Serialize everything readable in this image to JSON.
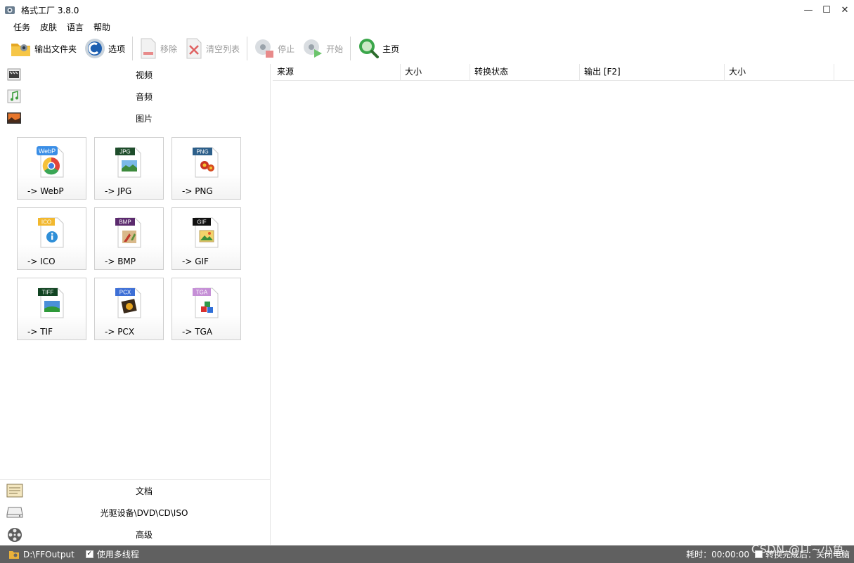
{
  "window": {
    "title": "格式工厂 3.8.0",
    "controls": [
      "—",
      "☐",
      "✕"
    ]
  },
  "menu": [
    "任务",
    "皮肤",
    "语言",
    "帮助"
  ],
  "toolbar": {
    "output_folder": "输出文件夹",
    "options": "选项",
    "remove": "移除",
    "clear_list": "清空列表",
    "stop": "停止",
    "start": "开始",
    "home": "主页"
  },
  "categories_top": [
    "视频",
    "音频",
    "图片"
  ],
  "image_formats": [
    {
      "badge": "WebP",
      "label": "-> WebP",
      "badge_color": "#3a8ee6"
    },
    {
      "badge": "JPG",
      "label": "-> JPG",
      "badge_color": "#1e4d2b"
    },
    {
      "badge": "PNG",
      "label": "-> PNG",
      "badge_color": "#2d5f8a"
    },
    {
      "badge": "ICO",
      "label": "-> ICO",
      "badge_color": "#f2b82e"
    },
    {
      "badge": "BMP",
      "label": "-> BMP",
      "badge_color": "#5b2a6e"
    },
    {
      "badge": "GIF",
      "label": "-> GIF",
      "badge_color": "#111111"
    },
    {
      "badge": "TIFF",
      "label": "-> TIF",
      "badge_color": "#114422"
    },
    {
      "badge": "PCX",
      "label": "-> PCX",
      "badge_color": "#3d6fd6"
    },
    {
      "badge": "TGA",
      "label": "-> TGA",
      "badge_color": "#c58fd6"
    }
  ],
  "categories_bottom": [
    "文档",
    "光驱设备\\DVD\\CD\\ISO",
    "高级"
  ],
  "table_headers": [
    "来源",
    "大小",
    "转换状态",
    "输出 [F2]",
    "大小"
  ],
  "status": {
    "path": "D:\\FFOutput",
    "multithread": "使用多线程",
    "elapsed": "耗时：00:00:00",
    "after_convert": "转换完成后：关闭电脑"
  },
  "watermark": "CSDN @IT~小鱼"
}
